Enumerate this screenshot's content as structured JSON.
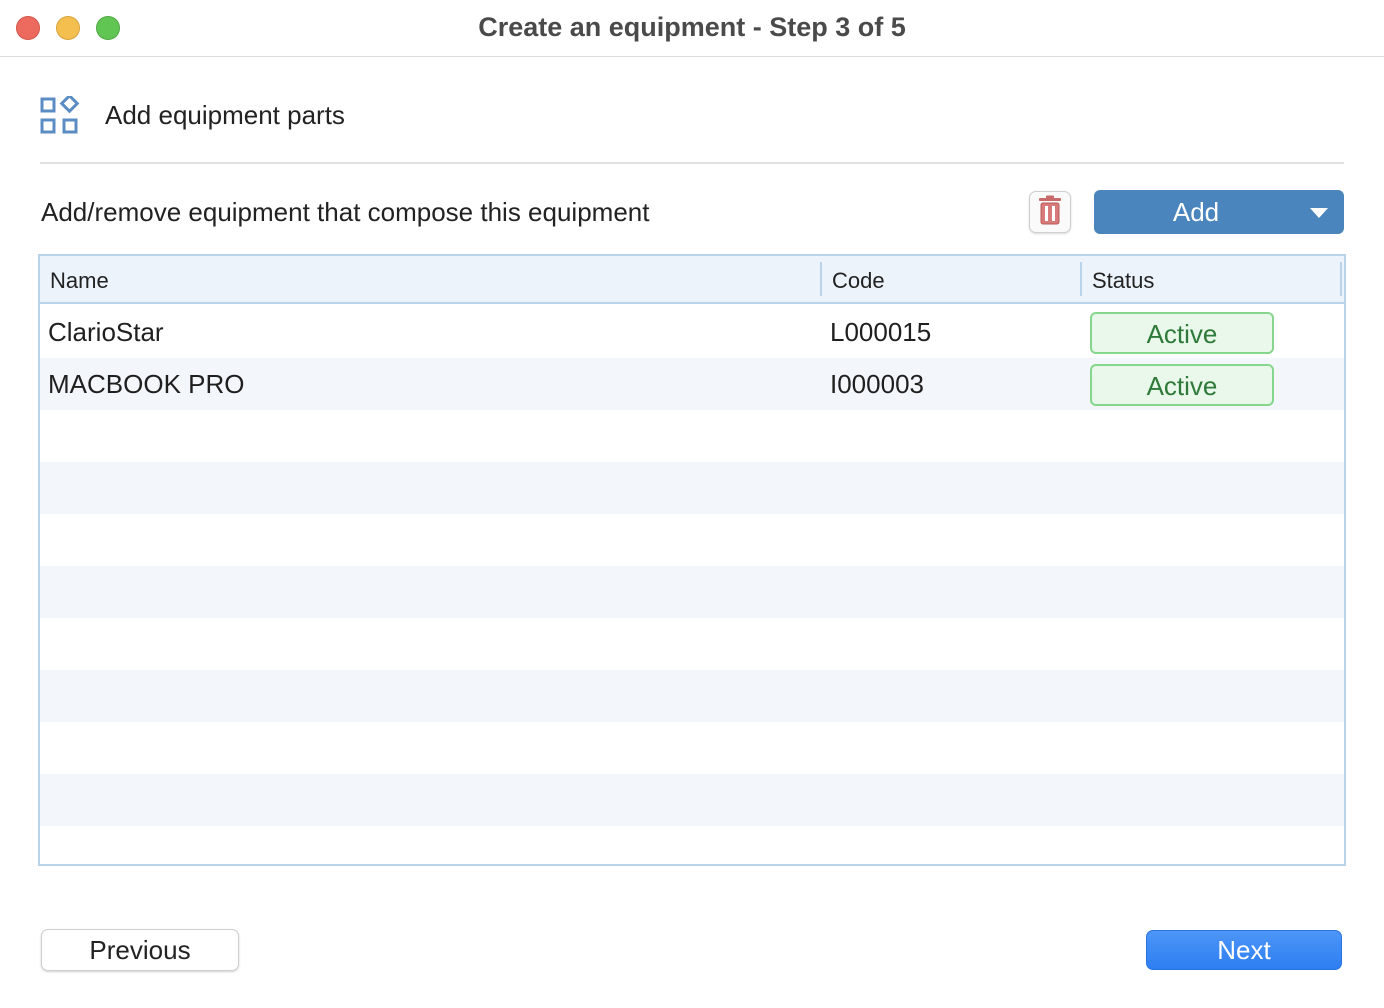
{
  "window": {
    "title": "Create an equipment - Step 3 of 5"
  },
  "section": {
    "title": "Add equipment parts",
    "icon": "grid-parts-icon"
  },
  "instruction": "Add/remove equipment that compose this equipment",
  "toolbar": {
    "delete_icon": "trash-icon",
    "add_label": "Add",
    "accent_color": "#4a85bd",
    "delete_color": "#c96a6a"
  },
  "table": {
    "columns": [
      "Name",
      "Code",
      "Status"
    ],
    "rows": [
      {
        "name": "ClarioStar",
        "code": "L000015",
        "status": "Active"
      },
      {
        "name": "MACBOOK PRO",
        "code": "I000003",
        "status": "Active"
      }
    ]
  },
  "footer": {
    "previous_label": "Previous",
    "next_label": "Next"
  }
}
